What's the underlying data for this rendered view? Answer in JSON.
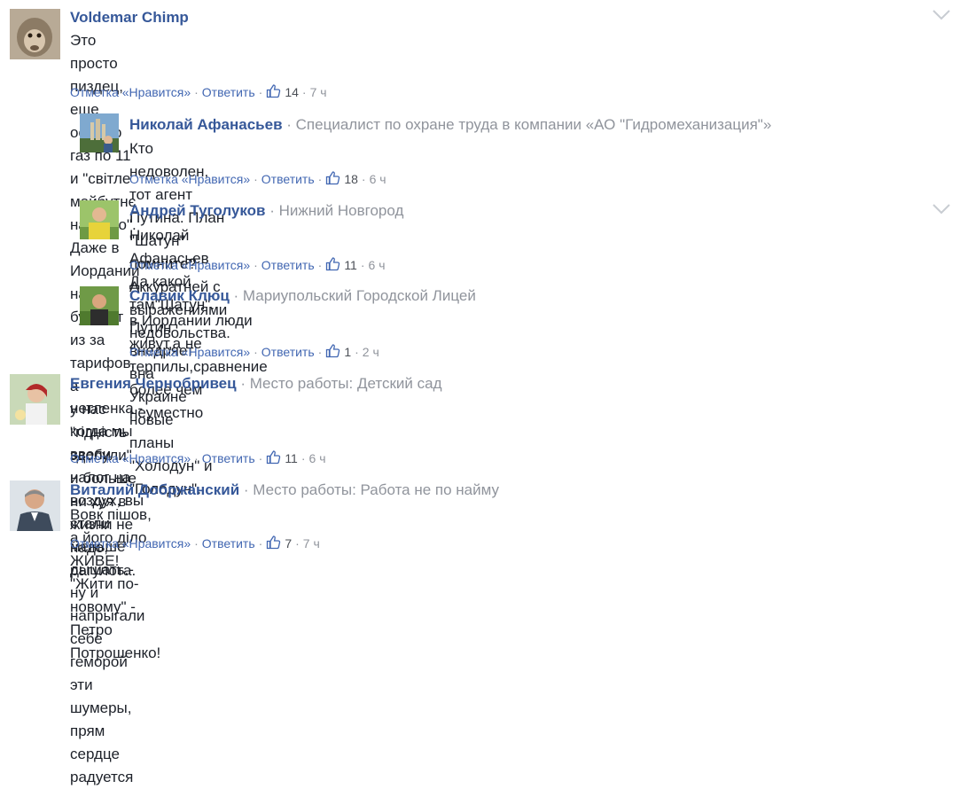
{
  "labels": {
    "like": "Отметка «Нравится»",
    "reply": "Ответить",
    "sep": "·"
  },
  "colors": {
    "author": "#365899",
    "link": "#4267b2",
    "meta": "#90949c",
    "text": "#1d2129"
  },
  "comments": [
    {
      "author": "Voldemar Chimp",
      "meta": "",
      "lines": [
        "Это просто пиздец, еще осенью газ по 11 и \"світле майбутнє настало\". Даже в Иордании народ бунтует из за тарифов, а",
        "у нас \"гідність здобули\" и больше ни хуя в жизни не надо, рагулота."
      ],
      "likes": "14",
      "time": "7 ч",
      "avatar": "monkey"
    },
    {
      "author": "Николай Афанасьев",
      "meta": "Специалист по охране труда в компании «АО \"Гидромеханизация\"»",
      "lines": [
        "Кто недоволен, тот агент Путина. План \"Шатун\" помните? Аккуратней с выражениями недовольства."
      ],
      "likes": "18",
      "time": "6 ч",
      "avatar": "castle"
    },
    {
      "author": "Андрей Туголуков",
      "meta": "Нижний Новгород",
      "lines": [
        "Николай Афанасьев Да какой там\"Шатун\". Путин внедряет вна Украине новые планы \"Холодун\" и \"Голодун\"."
      ],
      "likes": "11",
      "time": "6 ч",
      "avatar": "man-yellow"
    },
    {
      "author": "Славик Клюц",
      "meta": "Мариупольский Городской Лицей",
      "lines": [
        "в Иордании люди живут,а не терпилы,сравнение более чем неуместно"
      ],
      "likes": "1",
      "time": "2 ч",
      "avatar": "man-green"
    },
    {
      "author": "Евгения Чернобривец",
      "meta": "Место работы: Детский сад",
      "lines": [
        "нетленка - когда мы ввели налог на воздух, вы стали меньше дышать.- ну и напрыгали себе геморой эти шумеры, прям",
        "сердце радуется"
      ],
      "likes": "11",
      "time": "6 ч",
      "avatar": "woman"
    },
    {
      "author": "Виталий Добржанский",
      "meta": "Место работы: Работа не по найму",
      "lines": [
        "Вовк пішов, а його діло ЖИВЕ! \"Жити по-новому\" - Петро Потрошенко!"
      ],
      "likes": "7",
      "time": "7 ч",
      "avatar": "man-suit"
    }
  ]
}
